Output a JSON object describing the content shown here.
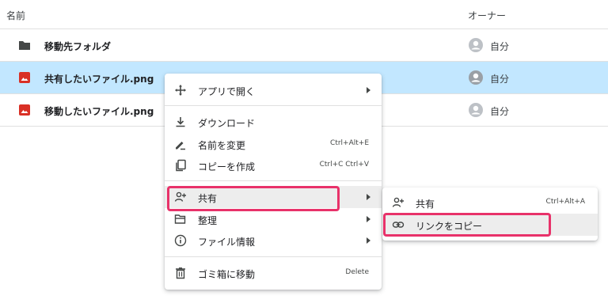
{
  "header": {
    "name_col": "名前",
    "owner_col": "オーナー"
  },
  "files": [
    {
      "name": "移動先フォルダ",
      "type": "folder",
      "owner": "自分",
      "selected": false,
      "icon": "folder-icon"
    },
    {
      "name": "共有したいファイル.png",
      "type": "image",
      "owner": "自分",
      "selected": true,
      "icon": "image-file-icon"
    },
    {
      "name": "移動したいファイル.png",
      "type": "image",
      "owner": "自分",
      "selected": false,
      "icon": "image-file-icon"
    }
  ],
  "context_menu": {
    "items": [
      {
        "label": "アプリで開く",
        "icon": "open-with-icon",
        "submenu": true
      },
      {
        "label": "ダウンロード",
        "icon": "download-icon"
      },
      {
        "label": "名前を変更",
        "icon": "rename-icon",
        "shortcut": "Ctrl+Alt+E"
      },
      {
        "label": "コピーを作成",
        "icon": "copy-icon",
        "shortcut": "Ctrl+C Ctrl+V"
      },
      {
        "label": "共有",
        "icon": "share-person-add-icon",
        "submenu": true,
        "highlighted": true
      },
      {
        "label": "整理",
        "icon": "folder-open-icon",
        "submenu": true
      },
      {
        "label": "ファイル情報",
        "icon": "info-icon",
        "submenu": true
      },
      {
        "label": "ゴミ箱に移動",
        "icon": "trash-icon",
        "shortcut": "Delete"
      }
    ]
  },
  "share_submenu": {
    "items": [
      {
        "label": "共有",
        "icon": "share-person-add-icon",
        "shortcut": "Ctrl+Alt+A"
      },
      {
        "label": "リンクをコピー",
        "icon": "link-icon",
        "highlighted": true
      }
    ]
  },
  "colors": {
    "selected_row": "#c2e7ff",
    "highlight_border": "#e8326a",
    "image_icon": "#d93025",
    "folder_icon": "#444746"
  }
}
